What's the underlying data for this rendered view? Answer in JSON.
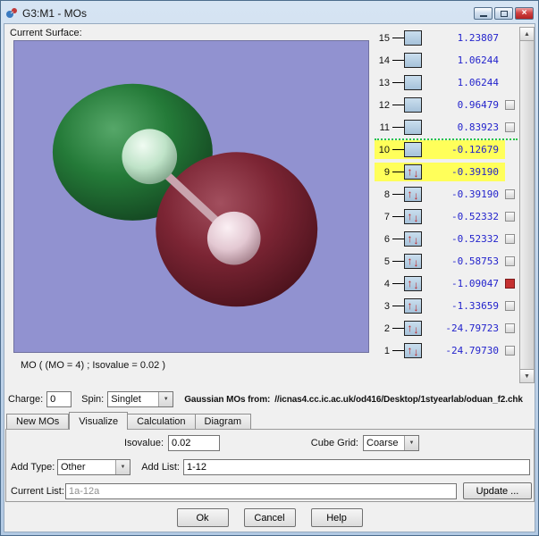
{
  "window": {
    "title": "G3:M1 - MOs"
  },
  "surface": {
    "label": "Current Surface:",
    "caption": "MO ( (MO = 4) ; Isovalue = 0.02 )"
  },
  "mo_list": {
    "rows": [
      {
        "num": 15,
        "energy": "1.23807",
        "occupied": false,
        "highlight": false,
        "checkbox": false,
        "checkbox_red": false,
        "divider_above": false
      },
      {
        "num": 14,
        "energy": "1.06244",
        "occupied": false,
        "highlight": false,
        "checkbox": false,
        "checkbox_red": false,
        "divider_above": false
      },
      {
        "num": 13,
        "energy": "1.06244",
        "occupied": false,
        "highlight": false,
        "checkbox": false,
        "checkbox_red": false,
        "divider_above": false
      },
      {
        "num": 12,
        "energy": "0.96479",
        "occupied": false,
        "highlight": false,
        "checkbox": true,
        "checkbox_red": false,
        "divider_above": false
      },
      {
        "num": 11,
        "energy": "0.83923",
        "occupied": false,
        "highlight": false,
        "checkbox": true,
        "checkbox_red": false,
        "divider_above": false
      },
      {
        "num": 10,
        "energy": "-0.12679",
        "occupied": false,
        "highlight": true,
        "checkbox": false,
        "checkbox_red": false,
        "divider_above": true
      },
      {
        "num": 9,
        "energy": "-0.39190",
        "occupied": true,
        "highlight": true,
        "checkbox": false,
        "checkbox_red": false,
        "divider_above": false
      },
      {
        "num": 8,
        "energy": "-0.39190",
        "occupied": true,
        "highlight": false,
        "checkbox": true,
        "checkbox_red": false,
        "divider_above": false
      },
      {
        "num": 7,
        "energy": "-0.52332",
        "occupied": true,
        "highlight": false,
        "checkbox": true,
        "checkbox_red": false,
        "divider_above": false
      },
      {
        "num": 6,
        "energy": "-0.52332",
        "occupied": true,
        "highlight": false,
        "checkbox": true,
        "checkbox_red": false,
        "divider_above": false
      },
      {
        "num": 5,
        "energy": "-0.58753",
        "occupied": true,
        "highlight": false,
        "checkbox": true,
        "checkbox_red": false,
        "divider_above": false
      },
      {
        "num": 4,
        "energy": "-1.09047",
        "occupied": true,
        "highlight": false,
        "checkbox": true,
        "checkbox_red": true,
        "divider_above": false
      },
      {
        "num": 3,
        "energy": "-1.33659",
        "occupied": true,
        "highlight": false,
        "checkbox": true,
        "checkbox_red": false,
        "divider_above": false
      },
      {
        "num": 2,
        "energy": "-24.79723",
        "occupied": true,
        "highlight": false,
        "checkbox": true,
        "checkbox_red": false,
        "divider_above": false
      },
      {
        "num": 1,
        "energy": "-24.79730",
        "occupied": true,
        "highlight": false,
        "checkbox": true,
        "checkbox_red": false,
        "divider_above": false
      }
    ]
  },
  "info": {
    "charge_label": "Charge:",
    "charge_value": "0",
    "spin_label": "Spin:",
    "spin_value": "Singlet",
    "source_label": "Gaussian MOs from:",
    "source_path": "//icnas4.cc.ic.ac.uk/od416/Desktop/1styearlab/oduan_f2.chk"
  },
  "tabs": [
    {
      "label": "New MOs",
      "active": false
    },
    {
      "label": "Visualize",
      "active": true
    },
    {
      "label": "Calculation",
      "active": false
    },
    {
      "label": "Diagram",
      "active": false
    }
  ],
  "visualize": {
    "isovalue_label": "Isovalue:",
    "isovalue_value": "0.02",
    "cube_grid_label": "Cube Grid:",
    "cube_grid_value": "Coarse",
    "add_type_label": "Add Type:",
    "add_type_value": "Other",
    "add_list_label": "Add List:",
    "add_list_value": "1-12",
    "current_list_label": "Current List:",
    "current_list_value": "1a-12a",
    "update_button": "Update ..."
  },
  "footer": {
    "ok": "Ok",
    "cancel": "Cancel",
    "help": "Help"
  },
  "icons": {
    "close": "×",
    "dropdown": "▼",
    "scroll_up": "▲",
    "scroll_down": "▼",
    "up_arrow": "↑",
    "down_arrow": "↓"
  },
  "colors": {
    "viewport_background": "#9192d0",
    "highlight_row": "#ffff5a",
    "energy_text": "#2323cc",
    "homo_lumo_divider": "#24c24a",
    "selected_mo_checkbox": "#c53030",
    "positive_lobe_green": "#1e6b30",
    "negative_lobe_red": "#7c2534"
  }
}
